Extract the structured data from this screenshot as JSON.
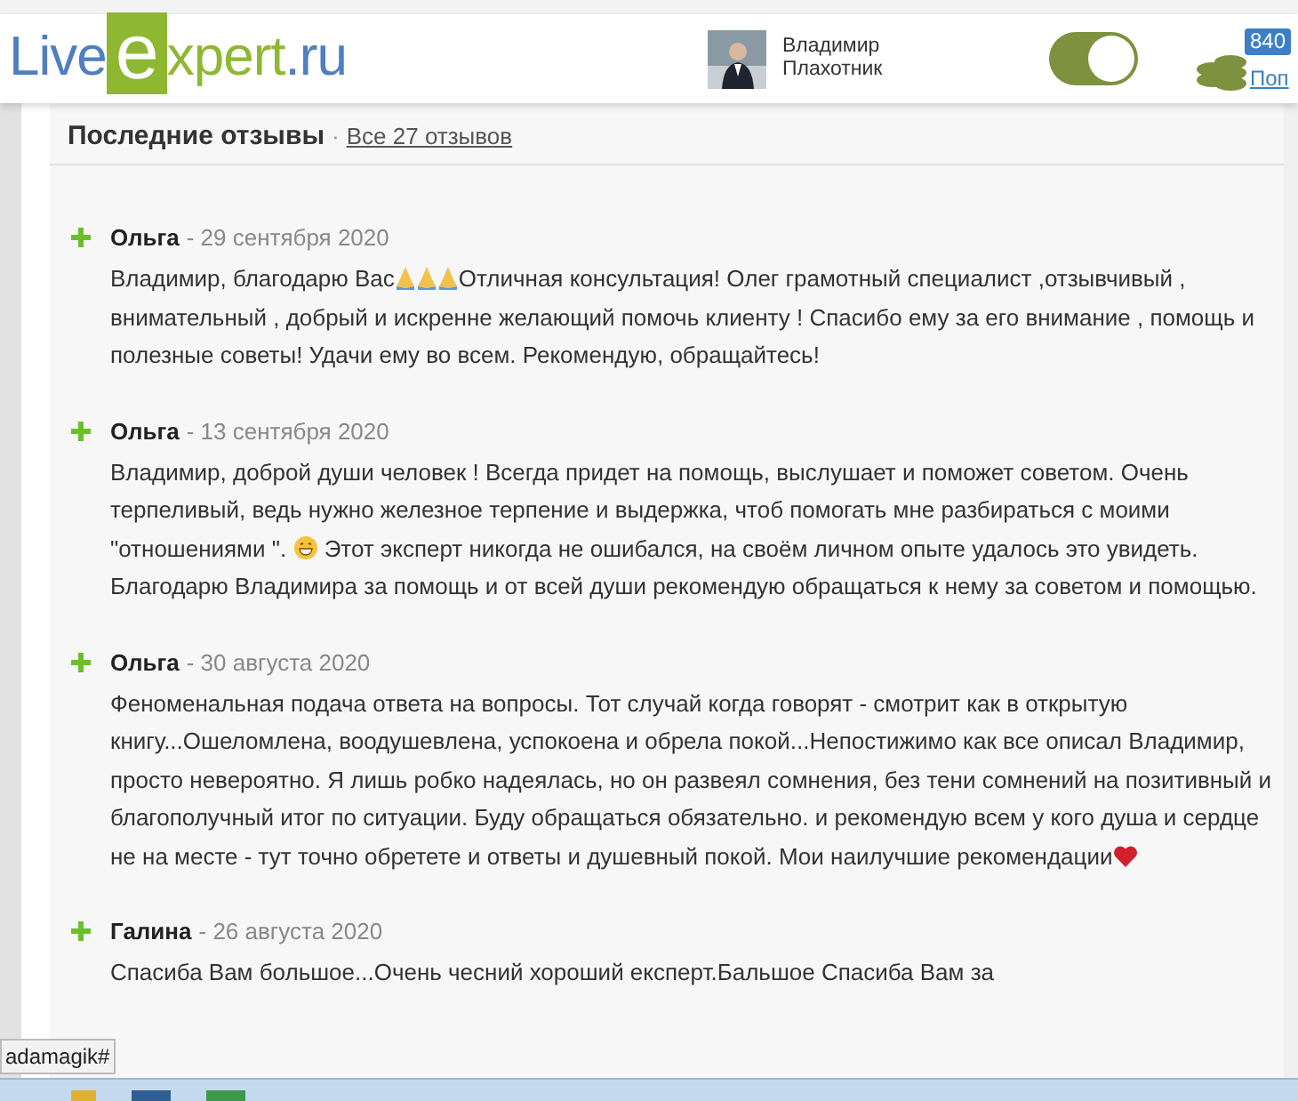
{
  "header": {
    "logo": {
      "part1": "Live",
      "letter": "e",
      "part2": "xpert.ru"
    },
    "user": {
      "first_name": "Владимир",
      "last_name": "Плахотник"
    },
    "toggle": {
      "on": true
    },
    "coins": {
      "badge": "840",
      "link": "Поп"
    }
  },
  "reviews_section": {
    "title": "Последние отзывы",
    "separator": "·",
    "all_link": "Все 27 отзывов"
  },
  "reviews": [
    {
      "author": "Ольга",
      "date": "- 29 сентября 2020",
      "positive": true,
      "body": [
        {
          "kind": "text",
          "text": "Владимир, благодарю Вас"
        },
        {
          "kind": "pray"
        },
        {
          "kind": "pray"
        },
        {
          "kind": "pray"
        },
        {
          "kind": "text",
          "text": "Отличная консультация! Олег грамотный специалист ,отзывчивый , внимательный , добрый и искренне желающий помочь клиенту ! Спасибо ему за его внимание , помощь и полезные советы! Удачи ему во всем. Рекомендую, обращайтесь!"
        }
      ]
    },
    {
      "author": "Ольга",
      "date": "- 13 сентября 2020",
      "positive": true,
      "body": [
        {
          "kind": "text",
          "text": "Владимир, доброй души человек ! Всегда придет на помощь, выслушает и поможет советом. Очень терпеливый, ведь нужно железное терпение и выдержка, чтоб помогать мне разбираться с моими \"отношениями \". "
        },
        {
          "kind": "grin"
        },
        {
          "kind": "text",
          "text": " Этот эксперт никогда не ошибался, на своём личном опыте удалось это увидеть. Благодарю Владимира за помощь и от всей души рекомендую обращаться к нему за советом и помощью."
        }
      ]
    },
    {
      "author": "Ольга",
      "date": "- 30 августа 2020",
      "positive": true,
      "body": [
        {
          "kind": "text",
          "text": "Феноменальная подача ответа на вопросы. Тот случай когда говорят - смотрит как в открытую книгу...Ошеломлена, воодушевлена, успокоена и обрела покой...Непостижимо как все описал Владимир, просто невероятно. Я лишь робко надеялась, но он развеял сомнения, без тени сомнений на позитивный и благополучный итог по ситуации. Буду обращаться обязательно. и рекомендую всем у кого душа и сердце не на месте - тут точно обретете и ответы и душевный покой. Мои наилучшие рекомендации"
        },
        {
          "kind": "heart"
        }
      ]
    },
    {
      "author": "Галина",
      "date": "- 26 августа 2020",
      "positive": true,
      "body": [
        {
          "kind": "text",
          "text": "Спасиба Вам большое...Очень чесний хороший експерт.Бальшое Спасиба Вам за"
        }
      ]
    }
  ],
  "status_link": "adamagik#"
}
